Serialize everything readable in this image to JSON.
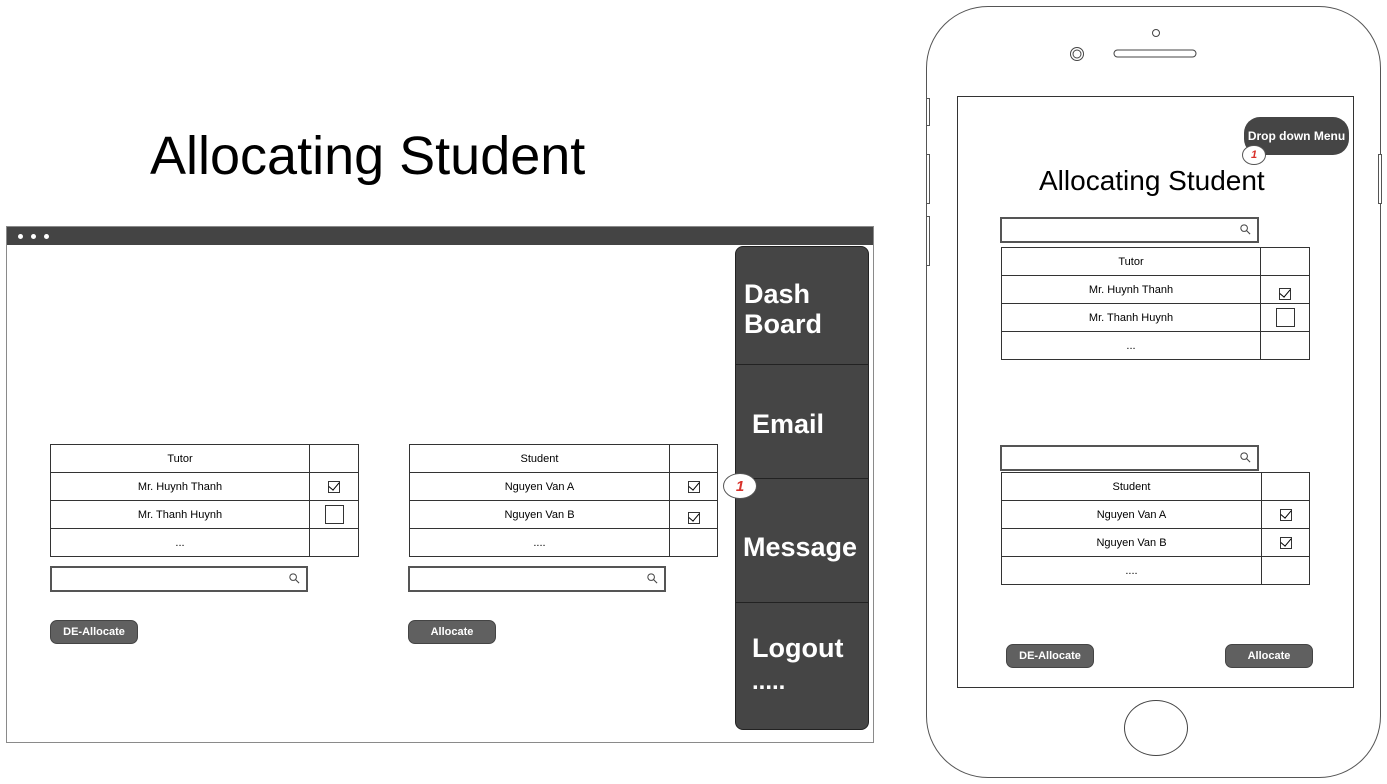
{
  "desktop": {
    "title": "Allocating Student",
    "tutor_table": {
      "header": "Tutor",
      "rows": [
        {
          "name": "Mr. Huynh Thanh",
          "checked": true
        },
        {
          "name": "Mr. Thanh Huynh",
          "checked": false
        },
        {
          "name": "...",
          "checked": null
        }
      ]
    },
    "student_table": {
      "header": "Student",
      "rows": [
        {
          "name": "Nguyen Van  A",
          "checked": true
        },
        {
          "name": "Nguyen Van B",
          "checked": true
        },
        {
          "name": "....",
          "checked": null
        }
      ]
    },
    "deallocate_label": "DE-Allocate",
    "allocate_label": "Allocate",
    "menu": {
      "dashboard_line1": "Dash",
      "dashboard_line2": "Board",
      "email": "Email",
      "message": "Message",
      "logout": "Logout",
      "more": "....."
    },
    "badge": "1"
  },
  "phone": {
    "dropdown_label": "Drop down Menu",
    "badge": "1",
    "title": "Allocating Student",
    "tutor_table": {
      "header": "Tutor",
      "rows": [
        {
          "name": "Mr. Huynh Thanh",
          "checked": true
        },
        {
          "name": "Mr. Thanh Huynh",
          "checked": false
        },
        {
          "name": "...",
          "checked": null
        }
      ]
    },
    "student_table": {
      "header": "Student",
      "rows": [
        {
          "name": "Nguyen Van  A",
          "checked": true
        },
        {
          "name": "Nguyen Van B",
          "checked": true
        },
        {
          "name": "....",
          "checked": null
        }
      ]
    },
    "deallocate_label": "DE-Allocate",
    "allocate_label": "Allocate"
  },
  "colors": {
    "dark": "#454545",
    "button": "#606060",
    "badge_text": "#d9322b"
  }
}
